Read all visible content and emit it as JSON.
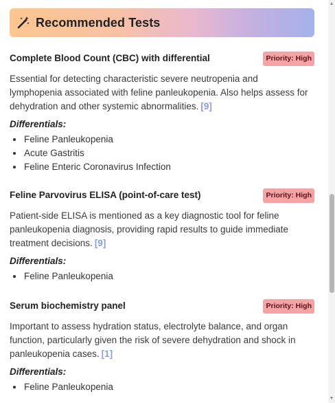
{
  "header": {
    "icon": "magic-wand-icon",
    "title": "Recommended Tests"
  },
  "colors": {
    "badge_bg": "#f6a3a6",
    "citation": "#8d9be0",
    "header_gradient_start": "#fdc68e",
    "header_gradient_end": "#a5b1ea"
  },
  "tests": [
    {
      "name": "Complete Blood Count (CBC) with differential",
      "priority": "Priority: High",
      "description": "Essential for detecting characteristic severe neutropenia and lymphopenia associated with feline panleukopenia. Also helps assess for dehydration and other systemic abnormalities.",
      "citation": "[9]",
      "differentials_label": "Differentials:",
      "differentials": [
        "Feline Panleukopenia",
        "Acute Gastritis",
        "Feline Enteric Coronavirus Infection"
      ]
    },
    {
      "name": "Feline Parvovirus ELISA (point-of-care test)",
      "priority": "Priority: High",
      "description": "Patient-side ELISA is mentioned as a key diagnostic tool for feline panleukopenia diagnosis, providing rapid results to guide immediate treatment decisions.",
      "citation": "[9]",
      "differentials_label": "Differentials:",
      "differentials": [
        "Feline Panleukopenia"
      ]
    },
    {
      "name": "Serum biochemistry panel",
      "priority": "Priority: High",
      "description": "Important to assess hydration status, electrolyte balance, and organ function, particularly given the risk of severe dehydration and shock in panleukopenia cases.",
      "citation": "[1]",
      "differentials_label": "Differentials:",
      "differentials": [
        "Feline Panleukopenia"
      ]
    }
  ]
}
